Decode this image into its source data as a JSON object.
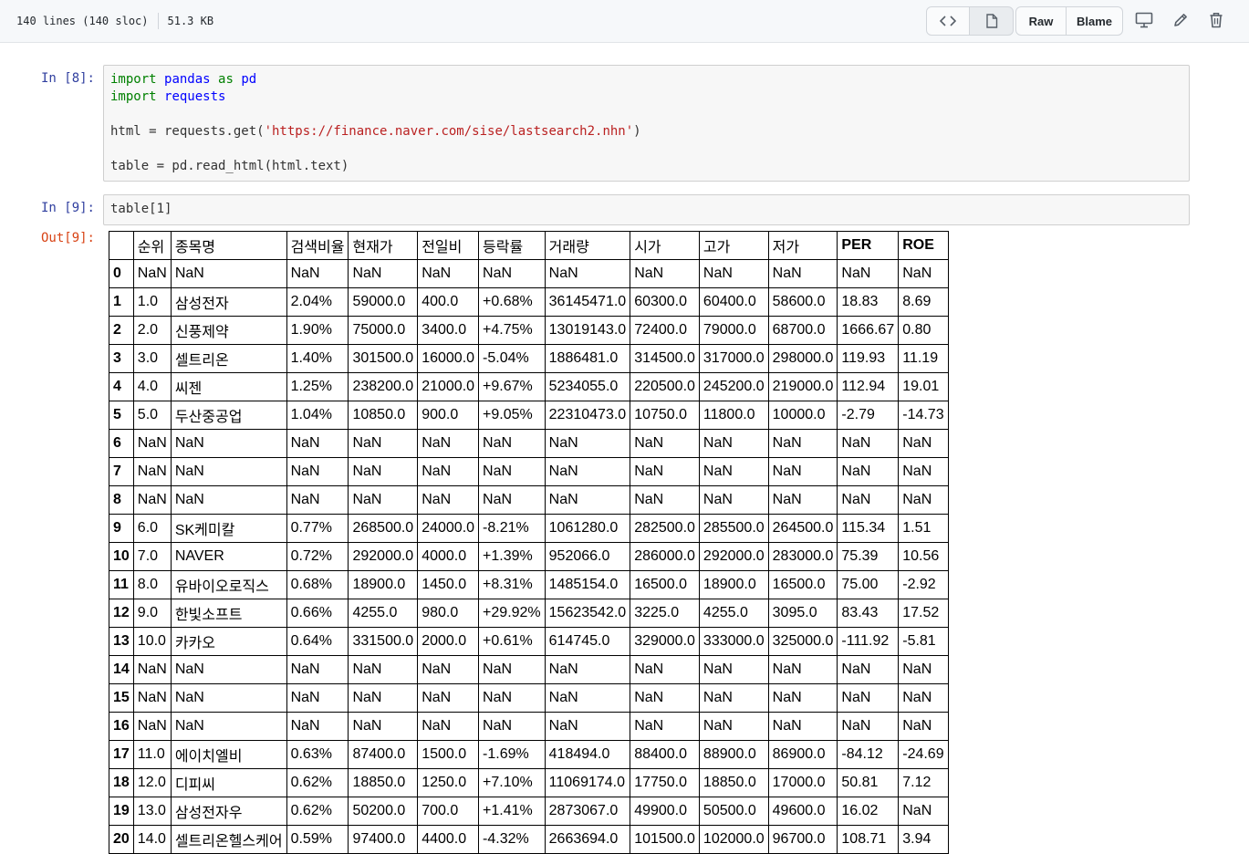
{
  "header": {
    "lines_info": "140 lines (140 sloc)",
    "size_info": "51.3 KB",
    "code_view_icon": "code-icon",
    "file_view_icon": "file-icon",
    "raw_label": "Raw",
    "blame_label": "Blame",
    "display_icon": "desktop-icon",
    "edit_icon": "pencil-icon",
    "delete_icon": "trash-icon"
  },
  "cells": {
    "cell8": {
      "prompt": "In [8]:",
      "line1": {
        "kw": "import",
        "mod": "pandas",
        "as": "as",
        "alias": "pd"
      },
      "line2": {
        "kw": "import",
        "mod": "requests"
      },
      "line3": {
        "pre": "html = requests.get(",
        "str": "'https://finance.naver.com/sise/lastsearch2.nhn'",
        "post": ")"
      },
      "line4": "table = pd.read_html(html.text)"
    },
    "cell9": {
      "prompt": "In [9]:",
      "code": "table[1]",
      "out_prompt": "Out[9]:"
    }
  },
  "table": {
    "columns": [
      "순위",
      "종목명",
      "검색비율",
      "현재가",
      "전일비",
      "등락률",
      "거래량",
      "시가",
      "고가",
      "저가",
      "PER",
      "ROE"
    ],
    "rows": [
      [
        "0",
        "NaN",
        "NaN",
        "NaN",
        "NaN",
        "NaN",
        "NaN",
        "NaN",
        "NaN",
        "NaN",
        "NaN",
        "NaN",
        "NaN"
      ],
      [
        "1",
        "1.0",
        "삼성전자",
        "2.04%",
        "59000.0",
        "400.0",
        "+0.68%",
        "36145471.0",
        "60300.0",
        "60400.0",
        "58600.0",
        "18.83",
        "8.69"
      ],
      [
        "2",
        "2.0",
        "신풍제약",
        "1.90%",
        "75000.0",
        "3400.0",
        "+4.75%",
        "13019143.0",
        "72400.0",
        "79000.0",
        "68700.0",
        "1666.67",
        "0.80"
      ],
      [
        "3",
        "3.0",
        "셀트리온",
        "1.40%",
        "301500.0",
        "16000.0",
        "-5.04%",
        "1886481.0",
        "314500.0",
        "317000.0",
        "298000.0",
        "119.93",
        "11.19"
      ],
      [
        "4",
        "4.0",
        "씨젠",
        "1.25%",
        "238200.0",
        "21000.0",
        "+9.67%",
        "5234055.0",
        "220500.0",
        "245200.0",
        "219000.0",
        "112.94",
        "19.01"
      ],
      [
        "5",
        "5.0",
        "두산중공업",
        "1.04%",
        "10850.0",
        "900.0",
        "+9.05%",
        "22310473.0",
        "10750.0",
        "11800.0",
        "10000.0",
        "-2.79",
        "-14.73"
      ],
      [
        "6",
        "NaN",
        "NaN",
        "NaN",
        "NaN",
        "NaN",
        "NaN",
        "NaN",
        "NaN",
        "NaN",
        "NaN",
        "NaN",
        "NaN"
      ],
      [
        "7",
        "NaN",
        "NaN",
        "NaN",
        "NaN",
        "NaN",
        "NaN",
        "NaN",
        "NaN",
        "NaN",
        "NaN",
        "NaN",
        "NaN"
      ],
      [
        "8",
        "NaN",
        "NaN",
        "NaN",
        "NaN",
        "NaN",
        "NaN",
        "NaN",
        "NaN",
        "NaN",
        "NaN",
        "NaN",
        "NaN"
      ],
      [
        "9",
        "6.0",
        "SK케미칼",
        "0.77%",
        "268500.0",
        "24000.0",
        "-8.21%",
        "1061280.0",
        "282500.0",
        "285500.0",
        "264500.0",
        "115.34",
        "1.51"
      ],
      [
        "10",
        "7.0",
        "NAVER",
        "0.72%",
        "292000.0",
        "4000.0",
        "+1.39%",
        "952066.0",
        "286000.0",
        "292000.0",
        "283000.0",
        "75.39",
        "10.56"
      ],
      [
        "11",
        "8.0",
        "유바이오로직스",
        "0.68%",
        "18900.0",
        "1450.0",
        "+8.31%",
        "1485154.0",
        "16500.0",
        "18900.0",
        "16500.0",
        "75.00",
        "-2.92"
      ],
      [
        "12",
        "9.0",
        "한빛소프트",
        "0.66%",
        "4255.0",
        "980.0",
        "+29.92%",
        "15623542.0",
        "3225.0",
        "4255.0",
        "3095.0",
        "83.43",
        "17.52"
      ],
      [
        "13",
        "10.0",
        "카카오",
        "0.64%",
        "331500.0",
        "2000.0",
        "+0.61%",
        "614745.0",
        "329000.0",
        "333000.0",
        "325000.0",
        "-111.92",
        "-5.81"
      ],
      [
        "14",
        "NaN",
        "NaN",
        "NaN",
        "NaN",
        "NaN",
        "NaN",
        "NaN",
        "NaN",
        "NaN",
        "NaN",
        "NaN",
        "NaN"
      ],
      [
        "15",
        "NaN",
        "NaN",
        "NaN",
        "NaN",
        "NaN",
        "NaN",
        "NaN",
        "NaN",
        "NaN",
        "NaN",
        "NaN",
        "NaN"
      ],
      [
        "16",
        "NaN",
        "NaN",
        "NaN",
        "NaN",
        "NaN",
        "NaN",
        "NaN",
        "NaN",
        "NaN",
        "NaN",
        "NaN",
        "NaN"
      ],
      [
        "17",
        "11.0",
        "에이치엘비",
        "0.63%",
        "87400.0",
        "1500.0",
        "-1.69%",
        "418494.0",
        "88400.0",
        "88900.0",
        "86900.0",
        "-84.12",
        "-24.69"
      ],
      [
        "18",
        "12.0",
        "디피씨",
        "0.62%",
        "18850.0",
        "1250.0",
        "+7.10%",
        "11069174.0",
        "17750.0",
        "18850.0",
        "17000.0",
        "50.81",
        "7.12"
      ],
      [
        "19",
        "13.0",
        "삼성전자우",
        "0.62%",
        "50200.0",
        "700.0",
        "+1.41%",
        "2873067.0",
        "49900.0",
        "50500.0",
        "49600.0",
        "16.02",
        "NaN"
      ],
      [
        "20",
        "14.0",
        "셀트리온헬스케어",
        "0.59%",
        "97400.0",
        "4400.0",
        "-4.32%",
        "2663694.0",
        "101500.0",
        "102000.0",
        "96700.0",
        "108.71",
        "3.94"
      ]
    ]
  }
}
